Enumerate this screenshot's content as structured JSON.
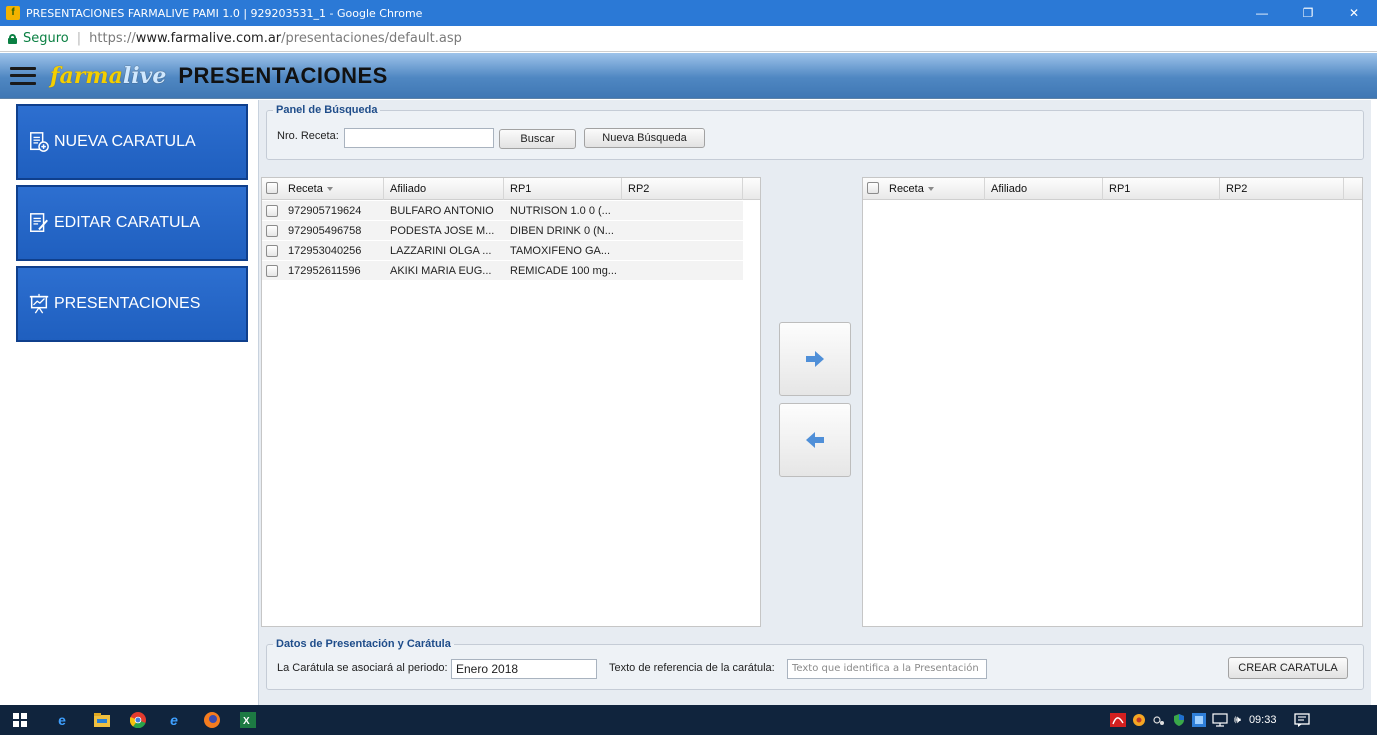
{
  "window": {
    "title": "PRESENTACIONES FARMALIVE PAMI 1.0 | 929203531_1 - Google Chrome",
    "favicon_letter": "f",
    "minimize": "—",
    "restore": "❐",
    "close": "✕"
  },
  "address": {
    "secure_label": "Seguro",
    "separator": "|",
    "scheme": "https://",
    "host": "www.farmalive.com.ar",
    "path": "/presentaciones/default.asp"
  },
  "header": {
    "brand_part1": "farma",
    "brand_part2": "live",
    "title": "PRESENTACIONES"
  },
  "sidebar": {
    "items": [
      {
        "label": "NUEVA CARATULA",
        "icon": "new-document-icon"
      },
      {
        "label": "EDITAR CARATULA",
        "icon": "edit-document-icon"
      },
      {
        "label": "PRESENTACIONES",
        "icon": "presentation-board-icon"
      }
    ]
  },
  "search": {
    "legend": "Panel de Búsqueda",
    "receta_label": "Nro. Receta:",
    "receta_value": "",
    "buscar": "Buscar",
    "nueva_busqueda": "Nueva Búsqueda"
  },
  "left_grid": {
    "columns": [
      "Receta",
      "Afiliado",
      "RP1",
      "RP2"
    ],
    "rows": [
      [
        "972905719624",
        "BULFARO ANTONIO",
        "NUTRISON 1.0 0 (...",
        ""
      ],
      [
        "972905496758",
        "PODESTA JOSE M...",
        "DIBEN DRINK 0 (N...",
        ""
      ],
      [
        "172953040256",
        "LAZZARINI OLGA ...",
        "TAMOXIFENO GA...",
        ""
      ],
      [
        "172952611596",
        "AKIKI MARIA EUG...",
        "REMICADE 100 mg...",
        ""
      ]
    ]
  },
  "right_grid": {
    "columns": [
      "Receta",
      "Afiliado",
      "RP1",
      "RP2"
    ],
    "rows": []
  },
  "transfer": {
    "move_right_icon": "arrow-right-icon",
    "move_left_icon": "arrow-left-icon"
  },
  "datos": {
    "legend": "Datos de Presentación y Carátula",
    "periodo_label": "La Carátula se asociará al periodo:",
    "periodo_value": "Enero 2018",
    "texto_label": "Texto de referencia de la carátula:",
    "texto_placeholder": "Texto que identifica a la  Presentación",
    "crear": "CREAR CARATULA"
  },
  "taskbar": {
    "clock": "09:33",
    "volume_glyph": "🕪"
  },
  "colors": {
    "titlebar": "#2b79d6",
    "nav_button": "#2566c7",
    "legend_text": "#1f4d8a",
    "taskbar": "#10243d"
  }
}
